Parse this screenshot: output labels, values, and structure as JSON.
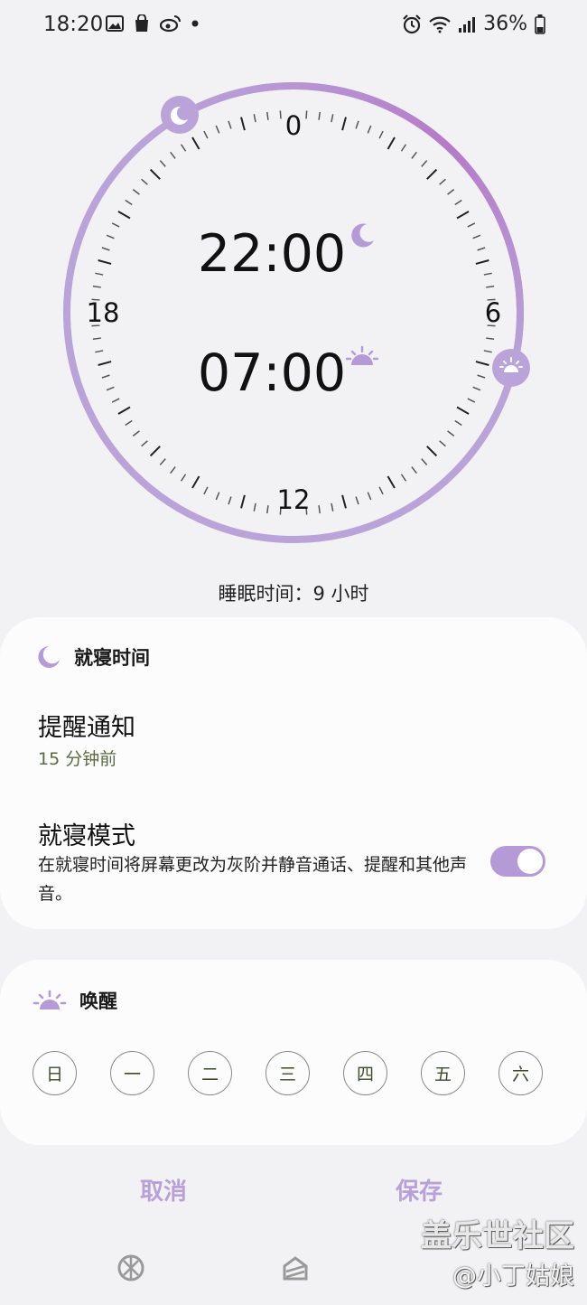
{
  "status_bar": {
    "time": "18:20",
    "battery": "36%"
  },
  "clock": {
    "labels": {
      "top": "0",
      "right": "6",
      "bottom": "12",
      "left": "18"
    },
    "bedtime": "22:00",
    "wake_time": "07:00",
    "colors": {
      "ring": "#b9a3d9",
      "ring_accent": "#b57ac8",
      "accent": "#b59ad8"
    }
  },
  "sleep_duration": "睡眠时间：9 小时",
  "bedtime_card": {
    "header": "就寝时间",
    "reminder_title": "提醒通知",
    "reminder_value": "15 分钟前",
    "mode_title": "就寝模式",
    "mode_desc": "在就寝时间将屏幕更改为灰阶并静音通话、提醒和其他声音。",
    "mode_enabled": true
  },
  "wake_card": {
    "header": "唤醒",
    "days": [
      "日",
      "一",
      "二",
      "三",
      "四",
      "五",
      "六"
    ]
  },
  "footer": {
    "cancel": "取消",
    "save": "保存"
  },
  "watermark": {
    "line1": "盖乐世社区",
    "line2": "@小丁姑娘"
  }
}
